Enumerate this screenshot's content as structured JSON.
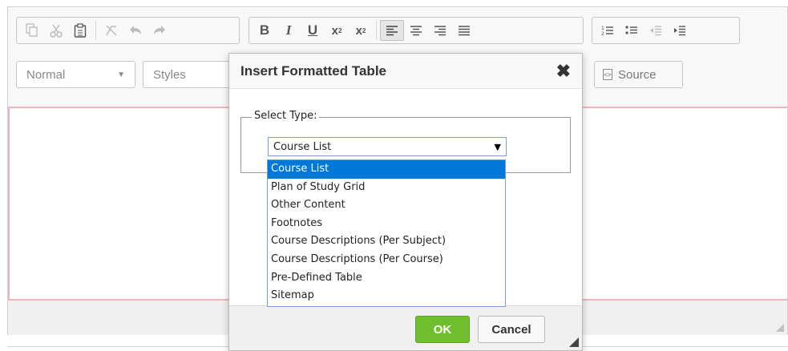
{
  "toolbar": {
    "row1_groups": [
      [
        "copy-icon",
        "cut-icon",
        "paste-icon",
        "remove-format-icon",
        "undo-icon",
        "redo-icon"
      ],
      [
        "bold-icon",
        "italic-icon",
        "underline-icon",
        "superscript-icon",
        "subscript-icon",
        "align-left-icon",
        "align-center-icon",
        "align-right-icon",
        "justify-icon"
      ],
      [
        "numbered-list-icon",
        "bulleted-list-icon",
        "outdent-icon",
        "indent-icon"
      ]
    ],
    "format_combo": "Normal",
    "styles_combo": "Styles",
    "source_label": "Source"
  },
  "dialog": {
    "title": "Insert Formatted Table",
    "close_glyph": "✖",
    "fieldset_legend": "Select Type:",
    "select_value": "Course List",
    "options": [
      "Course List",
      "Plan of Study Grid",
      "Other Content",
      "Footnotes",
      "Course Descriptions (Per Subject)",
      "Course Descriptions (Per Course)",
      "Pre-Defined Table",
      "Sitemap"
    ],
    "selected_option": "Course List",
    "ok_label": "OK",
    "cancel_label": "Cancel"
  },
  "colors": {
    "ok_green": "#6fbe2d",
    "selected_blue": "#0078d7",
    "content_border_pink": "#f0b5bb"
  }
}
